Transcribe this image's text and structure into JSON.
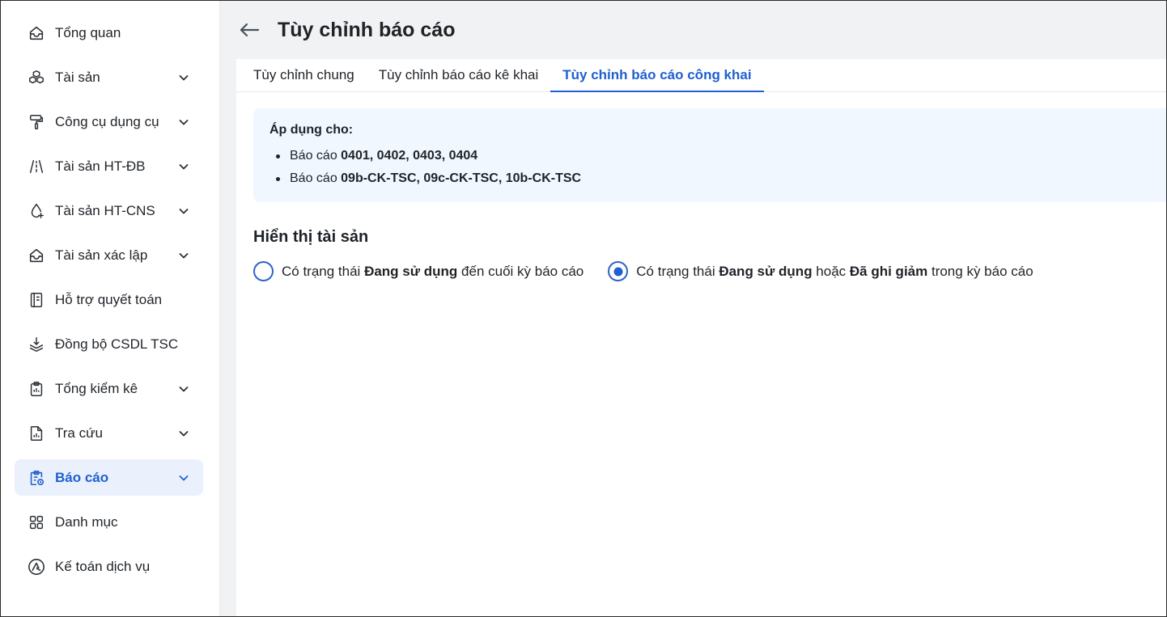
{
  "sidebar": {
    "items": [
      {
        "label": "Tổng quan",
        "icon": "home-icon",
        "has_chevron": false
      },
      {
        "label": "Tài sản",
        "icon": "cubes-icon",
        "has_chevron": true
      },
      {
        "label": "Công cụ dụng cụ",
        "icon": "paint-roller-icon",
        "has_chevron": true
      },
      {
        "label": "Tài sản HT-ĐB",
        "icon": "road-icon",
        "has_chevron": true
      },
      {
        "label": "Tài sản HT-CNS",
        "icon": "water-drop-icon",
        "has_chevron": true
      },
      {
        "label": "Tài sản xác lập",
        "icon": "inbox-icon",
        "has_chevron": true
      },
      {
        "label": "Hỗ trợ quyết toán",
        "icon": "notebook-icon",
        "has_chevron": false
      },
      {
        "label": "Đồng bộ CSDL TSC",
        "icon": "layers-download-icon",
        "has_chevron": false
      },
      {
        "label": "Tổng kiểm kê",
        "icon": "clipboard-icon",
        "has_chevron": true
      },
      {
        "label": "Tra cứu",
        "icon": "file-chart-icon",
        "has_chevron": true
      },
      {
        "label": "Báo cáo",
        "icon": "clipboard-clock-icon",
        "has_chevron": true,
        "active": true
      },
      {
        "label": "Danh mục",
        "icon": "grid-icon",
        "has_chevron": false
      },
      {
        "label": "Kế toán dịch vụ",
        "icon": "brand-circle-icon",
        "has_chevron": false
      }
    ]
  },
  "header": {
    "title": "Tùy chỉnh báo cáo"
  },
  "tabs": [
    {
      "label": "Tùy chỉnh chung",
      "active": false
    },
    {
      "label": "Tùy chỉnh báo cáo kê khai",
      "active": false
    },
    {
      "label": "Tùy chỉnh báo cáo công khai",
      "active": true
    }
  ],
  "info": {
    "title": "Áp dụng cho:",
    "items": [
      {
        "prefix": "Báo cáo ",
        "bold": "0401, 0402, 0403, 0404"
      },
      {
        "prefix": "Báo cáo ",
        "bold": "09b-CK-TSC, 09c-CK-TSC, 10b-CK-TSC"
      }
    ]
  },
  "display": {
    "title": "Hiển thị tài sản",
    "options": [
      {
        "p1": "Có trạng thái ",
        "b1": "Đang sử dụng",
        "p2": " đến cuối kỳ báo cáo",
        "b2": "",
        "p3": "",
        "checked": false
      },
      {
        "p1": "Có trạng thái ",
        "b1": "Đang sử dụng",
        "p2": " hoặc ",
        "b2": "Đã ghi giảm",
        "p3": " trong kỳ báo cáo",
        "checked": true
      }
    ]
  },
  "colors": {
    "accent": "#1f5fd1",
    "active_bg": "#eaf1fd",
    "info_bg": "#f1f7fe",
    "main_bg": "#f1f2f4"
  }
}
